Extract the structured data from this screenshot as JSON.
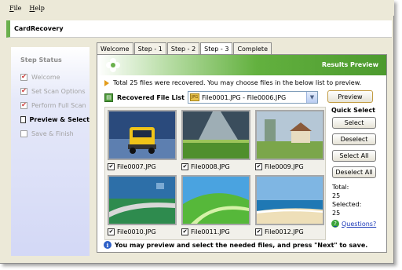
{
  "menu": {
    "file": "File",
    "help": "Help"
  },
  "app_title": "CardRecovery",
  "sidebar": {
    "heading": "Step Status",
    "steps": [
      {
        "label": "Welcome",
        "checked": true
      },
      {
        "label": "Set Scan Options",
        "checked": true
      },
      {
        "label": "Perform Full Scan",
        "checked": true
      },
      {
        "label": "Preview & Select",
        "checked": false,
        "active": true
      },
      {
        "label": "Save & Finish",
        "checked": false
      }
    ]
  },
  "tabs": [
    "Welcome",
    "Step - 1",
    "Step - 2",
    "Step - 3",
    "Complete"
  ],
  "active_tab": "Step - 3",
  "panel": {
    "header_title": "Results Preview",
    "info_text": "Total 25 files were recovered. You may choose files in the below list to preview.",
    "list_label": "Recovered File List",
    "combo_value": "File0001.JPG - File0006.JPG",
    "preview_button": "Preview"
  },
  "thumbnails": [
    {
      "name": "File0007.JPG",
      "checked": true,
      "scene": "truck"
    },
    {
      "name": "File0008.JPG",
      "checked": true,
      "scene": "sunbeam-field"
    },
    {
      "name": "File0009.JPG",
      "checked": true,
      "scene": "house"
    },
    {
      "name": "File0010.JPG",
      "checked": true,
      "scene": "coast-road"
    },
    {
      "name": "File0011.JPG",
      "checked": true,
      "scene": "green-wave"
    },
    {
      "name": "File0012.JPG",
      "checked": true,
      "scene": "beach"
    }
  ],
  "quick_select": {
    "title": "Quick Select",
    "select": "Select",
    "deselect": "Deselect",
    "select_all": "Select All",
    "deselect_all": "Deselect All",
    "total_label": "Total:",
    "total_value": "25",
    "selected_label": "Selected:",
    "selected_value": "25",
    "questions": "Questions?"
  },
  "footer_text": "You may preview and select the needed files, and press \"Next\" to save.",
  "colors": {
    "accent_green": "#5aa83a",
    "checkmark_red": "#cc3333",
    "link_blue": "#1a38b8"
  }
}
